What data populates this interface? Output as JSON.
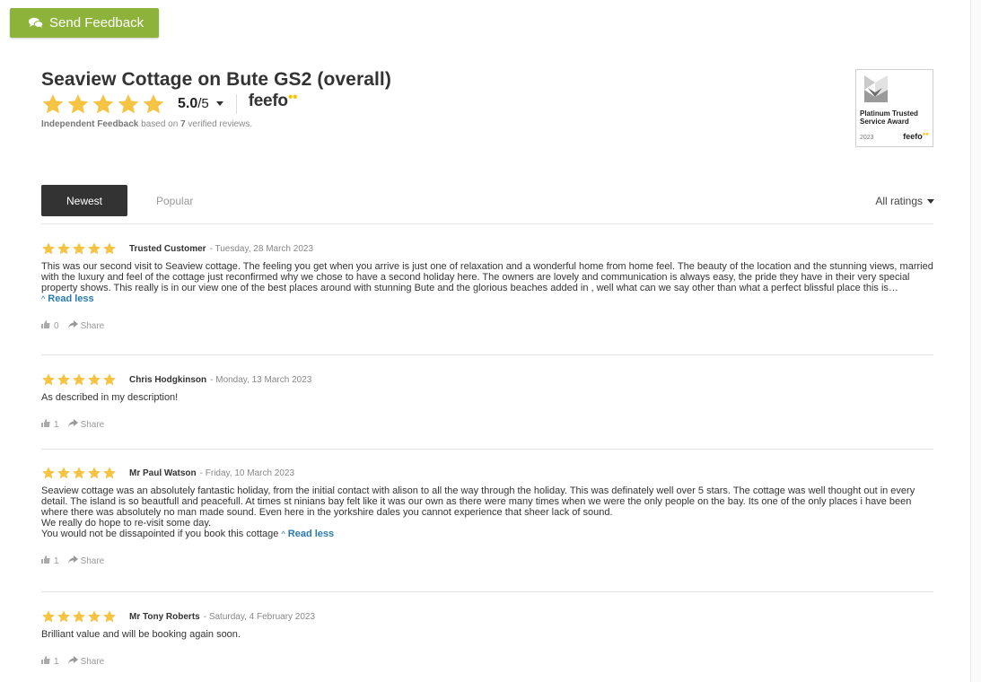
{
  "feedback_button": {
    "label": "Send Feedback",
    "icon": "chat-bubbles-icon",
    "color": "#8db33a"
  },
  "header": {
    "title": "Seaview Cottage on Bute GS2 (overall)",
    "score": "5.0",
    "score_suffix": "/5",
    "stars": 5,
    "star_color": "#f6c343",
    "brand": "feefo",
    "sub_line_strong": "Independent Feedback",
    "sub_line_mid": " based on ",
    "review_count": "7",
    "sub_line_end": " verified reviews."
  },
  "badge": {
    "title_line1": "Platinum Trusted",
    "title_line2": "Service Award",
    "year": "2023",
    "brand": "feefo"
  },
  "tabs": {
    "active": "Newest",
    "other": "Popular"
  },
  "filter": {
    "label": "All ratings"
  },
  "reviews": [
    {
      "stars": 5,
      "name": "Trusted Customer",
      "date": " - Tuesday, 28 March 2023",
      "text_lines": [
        "This was our second visit to Seaview cottage. The feeling you get when you arrive is just one of relaxation and a wonderful home from home feel. The beauty of the location and the stunning views, married with the  luxury and feel of the cottage just reconfirmed why we chose to have a second holiday here. The owners are lovely and communication is always easy, the pride they have in their very special property shows. This really is in our view one of the best places around with stunning Bute and the glorious beaches added in , well what can we say other than what a perfect blissful place this is…"
      ],
      "read_less": "Read less",
      "likes": "0",
      "share": "Share"
    },
    {
      "stars": 5,
      "name": "Chris Hodgkinson",
      "date": " - Monday, 13 March 2023",
      "text_lines": [
        "As described in my description!"
      ],
      "read_less": "",
      "likes": "1",
      "share": "Share"
    },
    {
      "stars": 5,
      "name": "Mr Paul Watson",
      "date": " - Friday, 10 March 2023",
      "text_lines": [
        "Seaview cottage was an absolutely fantastic holiday, from the initial contact with alison to all the way through the holiday. This was definately well over 5 stars. The cottage was well thought out in every detail. The island is so beautfull and peacefull. At times st ninians bay felt like it was our own as there were many times when we were the only people on the bay. Its one of the only places i have been where there was absolutely no man made sound. Even here in the yorkshire dales you cannot experience that sheer lack of sound.",
        "We really do hope to re-visit some day.",
        "You would not be dissapointed if you book this cottage"
      ],
      "read_less": "Read less",
      "likes": "1",
      "share": "Share"
    },
    {
      "stars": 5,
      "name": "Mr Tony Roberts",
      "date": " - Saturday, 4 February 2023",
      "text_lines": [
        "Brilliant value and will be booking again soon."
      ],
      "read_less": "",
      "likes": "1",
      "share": "Share"
    }
  ]
}
